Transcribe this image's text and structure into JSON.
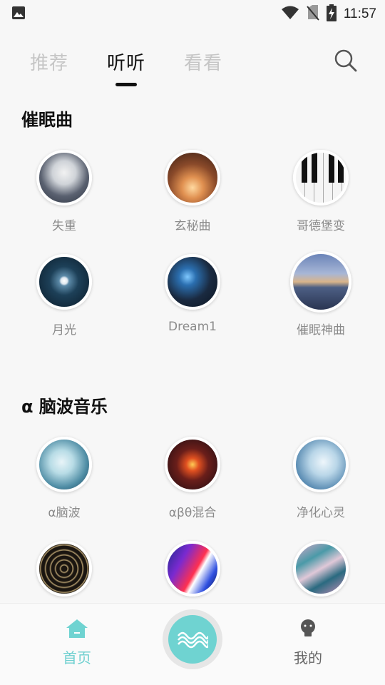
{
  "status_bar": {
    "time": "11:57"
  },
  "tabs": [
    {
      "label": "推荐",
      "active": false
    },
    {
      "label": "听听",
      "active": true
    },
    {
      "label": "看看",
      "active": false
    }
  ],
  "sections": [
    {
      "title": "催眠曲",
      "items": [
        {
          "label": "失重"
        },
        {
          "label": "玄秘曲"
        },
        {
          "label": "哥德堡变"
        },
        {
          "label": "月光"
        },
        {
          "label": "Dream1"
        },
        {
          "label": "催眠神曲"
        }
      ]
    },
    {
      "title": "α 脑波音乐",
      "items": [
        {
          "label": "α脑波"
        },
        {
          "label": "αβθ混合"
        },
        {
          "label": "净化心灵"
        }
      ]
    }
  ],
  "bottom_nav": {
    "home_label": "首页",
    "me_label": "我的"
  },
  "colors": {
    "accent": "#6fd3d1",
    "tab_inactive": "#c6c6c6"
  }
}
